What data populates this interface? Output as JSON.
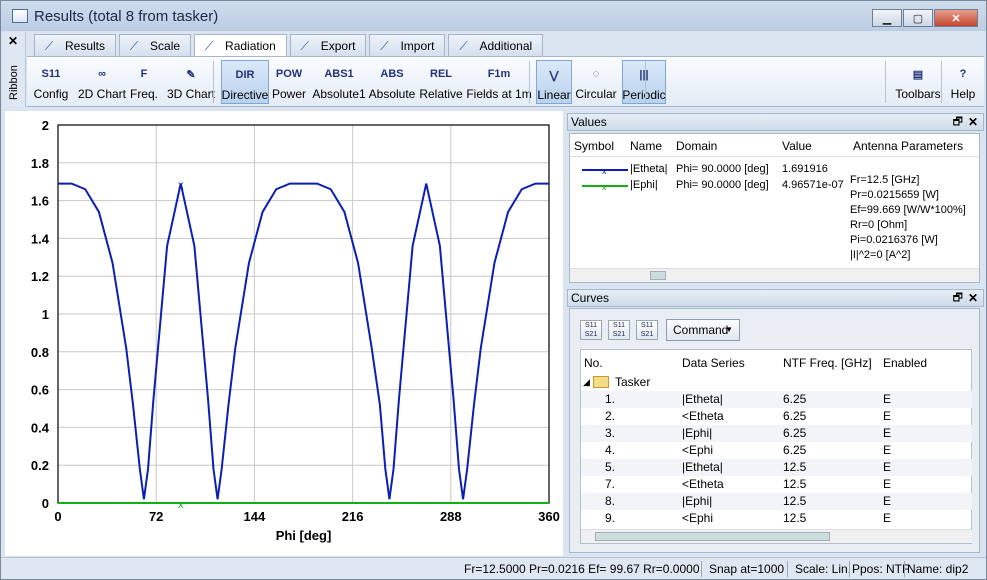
{
  "window": {
    "title": "Results (total 8 from tasker)",
    "minimize": "▁",
    "maximize": "▢",
    "close": "✕"
  },
  "ribbon": {
    "side_close": "✕",
    "side_label": "Ribbon"
  },
  "tabs": [
    {
      "label": "Results",
      "icon": "results-icon"
    },
    {
      "label": "Scale",
      "icon": "scale-icon"
    },
    {
      "label": "Radiation",
      "icon": "radiation-icon",
      "active": true
    },
    {
      "label": "Export",
      "icon": "export-icon"
    },
    {
      "label": "Import",
      "icon": "import-icon"
    },
    {
      "label": "Additional",
      "icon": "additional-icon"
    }
  ],
  "toolbar": {
    "buttons": [
      {
        "label": "Config",
        "glyph": "S11"
      },
      {
        "label": "2D Chart",
        "glyph": "∞"
      },
      {
        "label": "Freq.",
        "glyph": "F"
      },
      {
        "label": "3D Chart",
        "glyph": "✎"
      },
      {
        "label": "Directive",
        "glyph": "DIR",
        "pressed": true
      },
      {
        "label": "Power",
        "glyph": "POW"
      },
      {
        "label": "Absolute1",
        "glyph": "ABS1"
      },
      {
        "label": "Absolute",
        "glyph": "ABS"
      },
      {
        "label": "Relative",
        "glyph": "REL"
      },
      {
        "label": "Fields at 1m",
        "glyph": "F1m"
      },
      {
        "label": "Linear",
        "glyph": "⋁",
        "pressed": true
      },
      {
        "label": "Circular",
        "glyph": "◌"
      },
      {
        "label": "Periodic",
        "glyph": "|||",
        "pressed": true
      },
      {
        "label": "Toolbars",
        "glyph": "▤"
      },
      {
        "label": "Help",
        "glyph": "?"
      }
    ]
  },
  "chart_data": {
    "type": "line",
    "xlabel": "Phi [deg]",
    "ylabel": "",
    "xlim": [
      0,
      360
    ],
    "ylim": [
      0,
      2
    ],
    "xticks": [
      "0",
      "72",
      "144",
      "216",
      "288",
      "360"
    ],
    "yticks": [
      "0",
      "0.2",
      "0.4",
      "0.6",
      "0.8",
      "1",
      "1.2",
      "1.4",
      "1.6",
      "1.8",
      "2"
    ],
    "grid": true,
    "marker_x": 90,
    "series": [
      {
        "color": "#0b1fb3",
        "x": [
          0,
          10,
          20,
          30,
          40,
          50,
          55,
          60,
          63,
          66,
          70,
          80,
          90,
          100,
          110,
          114,
          117,
          120,
          125,
          130,
          140,
          150,
          160,
          170,
          180,
          190,
          200,
          210,
          220,
          230,
          236,
          240,
          243,
          246,
          250,
          260,
          270,
          280,
          290,
          294,
          297,
          300,
          305,
          310,
          320,
          330,
          340,
          350,
          360
        ],
        "y": [
          1.69,
          1.69,
          1.66,
          1.54,
          1.27,
          0.82,
          0.52,
          0.18,
          0.02,
          0.18,
          0.55,
          1.36,
          1.69,
          1.36,
          0.55,
          0.18,
          0.02,
          0.18,
          0.52,
          0.82,
          1.27,
          1.54,
          1.66,
          1.69,
          1.69,
          1.69,
          1.66,
          1.54,
          1.27,
          0.82,
          0.52,
          0.18,
          0.02,
          0.18,
          0.55,
          1.36,
          1.69,
          1.36,
          0.55,
          0.18,
          0.02,
          0.18,
          0.52,
          0.82,
          1.27,
          1.54,
          1.66,
          1.69,
          1.69
        ]
      },
      {
        "color": "#12b012",
        "x": [
          0,
          360
        ],
        "y": [
          0.0,
          0.0
        ]
      }
    ]
  },
  "values": {
    "title": "Values",
    "columns": [
      "Symbol",
      "Name",
      "Domain",
      "Value",
      "Antenna Parameters"
    ],
    "rows": [
      {
        "name": "|Etheta|",
        "domain": "Phi= 90.0000 [deg]",
        "value": "1.691916",
        "color": "#0b1fb3"
      },
      {
        "name": "|Ephi|",
        "domain": "Phi= 90.0000 [deg]",
        "value": "4.96571e-07",
        "color": "#12b012"
      }
    ],
    "antenna_params": [
      "Fr=12.5 [GHz]",
      "Pr=0.0215659 [W]",
      "Ef=99.669 [W/W*100%]",
      "Rr=0 [Ohm]",
      "Pi=0.0216376 [W]",
      "|I|^2=0 [A^2]"
    ]
  },
  "curves": {
    "title": "Curves",
    "command_label": "Command",
    "columns": [
      "No.",
      "Data Series",
      "NTF Freq. [GHz]",
      "Enabled"
    ],
    "group": "Tasker",
    "rows": [
      {
        "no": "1.",
        "series": "|Etheta|",
        "freq": "6.25",
        "enabled": "E"
      },
      {
        "no": "2.",
        "series": "<Etheta",
        "freq": "6.25",
        "enabled": "E"
      },
      {
        "no": "3.",
        "series": "|Ephi|",
        "freq": "6.25",
        "enabled": "E"
      },
      {
        "no": "4.",
        "series": "<Ephi",
        "freq": "6.25",
        "enabled": "E"
      },
      {
        "no": "5.",
        "series": "|Etheta|",
        "freq": "12.5",
        "enabled": "E"
      },
      {
        "no": "7.",
        "series": "<Etheta",
        "freq": "12.5",
        "enabled": "E"
      },
      {
        "no": "8.",
        "series": "|Ephi|",
        "freq": "12.5",
        "enabled": "E"
      },
      {
        "no": "9.",
        "series": "<Ephi",
        "freq": "12.5",
        "enabled": "E"
      }
    ]
  },
  "status": {
    "summary": "Fr=12.5000 Pr=0.0216 Ef= 99.67 Rr=0.0000",
    "snap": "Snap at=1000",
    "scale": "Scale: Lin.",
    "ppos": "Ppos: NTF",
    "name": "Name: dip2"
  }
}
